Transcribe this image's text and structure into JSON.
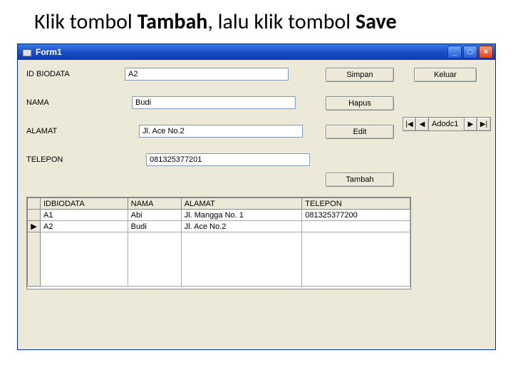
{
  "slide_title": {
    "part1": "Klik tombol ",
    "bold1": "Tambah",
    "part2": ", lalu klik tombol ",
    "bold2": "Save"
  },
  "window": {
    "title": "Form1",
    "min_glyph": "_",
    "max_glyph": "□",
    "close_glyph": "×"
  },
  "labels": {
    "id_biodata": "ID BIODATA",
    "nama": "NAMA",
    "alamat": "ALAMAT",
    "telepon": "TELEPON"
  },
  "inputs": {
    "id_biodata": "A2",
    "nama": "Budi",
    "alamat": "Jl. Ace No.2",
    "telepon": "081325377201"
  },
  "buttons": {
    "simpan": "Simpan",
    "keluar": "Keluar",
    "hapus": "Hapus",
    "edit": "Edit",
    "tambah": "Tambah"
  },
  "adodc": {
    "first_glyph": "|◀",
    "prev_glyph": "◀",
    "label": "Adodc1",
    "next_glyph": "▶",
    "last_glyph": "▶|"
  },
  "grid": {
    "headers": {
      "idbiodata": "IDBIODATA",
      "nama": "NAMA",
      "alamat": "ALAMAT",
      "telepon": "TELEPON"
    },
    "rows": [
      {
        "marker": "",
        "idbiodata": "A1",
        "nama": "Abi",
        "alamat": "Jl. Mangga No. 1",
        "telepon": "081325377200"
      },
      {
        "marker": "▶",
        "idbiodata": "A2",
        "nama": "Budi",
        "alamat": "Jl. Ace No.2",
        "telepon": ""
      }
    ]
  }
}
